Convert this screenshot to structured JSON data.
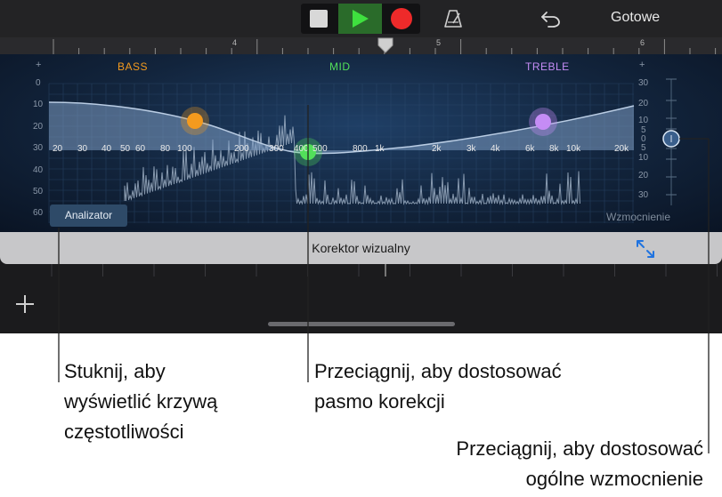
{
  "toolbar": {
    "done_label": "Gotowe",
    "icons": [
      "stop-icon",
      "play-icon",
      "record-icon",
      "metronome-icon",
      "undo-icon"
    ]
  },
  "ruler": {
    "marks": [
      "4",
      "5",
      "6"
    ]
  },
  "eq": {
    "bands": {
      "bass": "BASS",
      "mid": "MID",
      "treble": "TREBLE"
    },
    "band_colors": {
      "bass": "#f39a1e",
      "mid": "#52e05a",
      "treble": "#c58cf5"
    },
    "db_left": [
      "0",
      "10",
      "20",
      "30",
      "40",
      "50",
      "60"
    ],
    "db_right": [
      "30",
      "20",
      "10",
      "5",
      "0",
      "5",
      "10",
      "20",
      "30"
    ],
    "frequencies": [
      "20",
      "30",
      "40",
      "50",
      "60",
      "80",
      "100",
      "200",
      "300",
      "400",
      "500",
      "800",
      "1k",
      "2k",
      "3k",
      "4k",
      "6k",
      "8k",
      "10k",
      "20k"
    ],
    "plus_sign": "+",
    "analyzer_button": "Analizator",
    "gain_label": "Wzmocnienie",
    "title": "Korektor wizualny"
  },
  "callouts": {
    "analyzer": "Stuknij, aby\nwyświetlić krzywą\nczęstotliwości",
    "band": "Przeciągnij, aby dostosować\npasmo korekcji",
    "gain": "Przeciągnij, aby dostosować\nogólne wzmocnienie"
  }
}
